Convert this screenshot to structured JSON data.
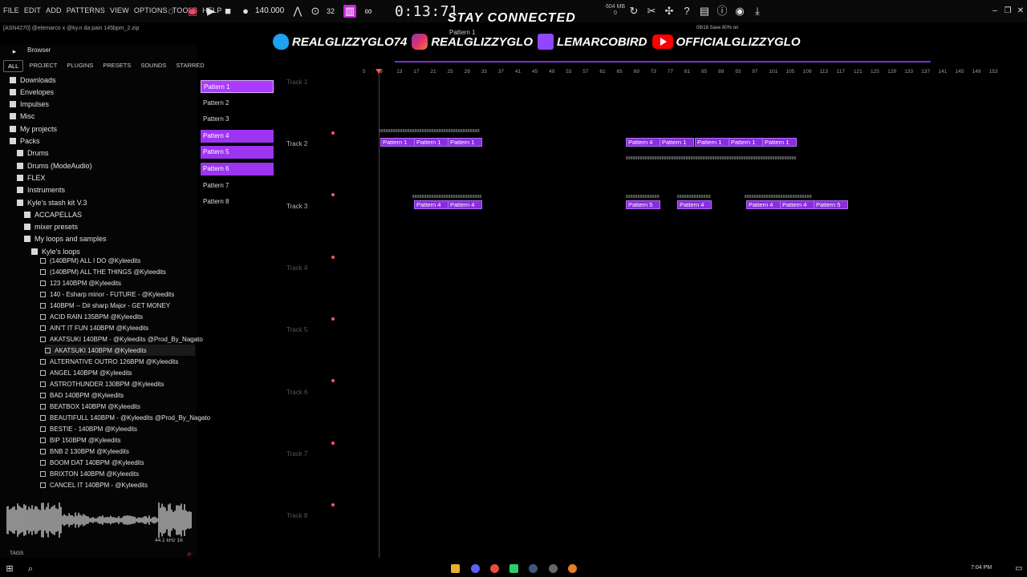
{
  "menu": [
    "FILE",
    "EDIT",
    "ADD",
    "PATTERNS",
    "VIEW",
    "OPTIONS",
    "TOOLS",
    "HELP"
  ],
  "transport": {
    "tempo": "140.000",
    "time": "0:13:71"
  },
  "system": {
    "ram": "604 MB",
    "cpu": "0"
  },
  "project_name": "[ASN4270] @elemarco x @ky.n da pain 145bpm_2.zip",
  "pattern_selector": "Pattern 1",
  "hint": "09/18 Save 80% on",
  "overlay": {
    "stay_connected": "STAY CONNECTED",
    "socials": [
      {
        "icon": "twitter-icon",
        "handle": "REALGLIZZYGLO74",
        "color": "#1da1f2"
      },
      {
        "icon": "instagram-icon",
        "handle": "REALGLIZZYGLO",
        "color": "#e1306c"
      },
      {
        "icon": "twitch-icon",
        "handle": "LEMARCOBIRD",
        "color": "#9146ff"
      },
      {
        "icon": "youtube-icon",
        "handle": "OFFICIALGLIZZYGLO",
        "color": "#ff0000"
      }
    ]
  },
  "browser": {
    "title": "Browser",
    "tabs": [
      "ALL",
      "PROJECT",
      "PLUGINS",
      "PRESETS",
      "SOUNDS",
      "STARRED"
    ],
    "folders": [
      {
        "label": "Downloads",
        "level": 0
      },
      {
        "label": "Envelopes",
        "level": 0
      },
      {
        "label": "Impulses",
        "level": 0
      },
      {
        "label": "Misc",
        "level": 0
      },
      {
        "label": "My projects",
        "level": 0
      },
      {
        "label": "Packs",
        "level": 0
      },
      {
        "label": "Drums",
        "level": 1
      },
      {
        "label": "Drums (ModeAudio)",
        "level": 1
      },
      {
        "label": "FLEX",
        "level": 1
      },
      {
        "label": "Instruments",
        "level": 1
      },
      {
        "label": "Kyle's stash kit V.3",
        "level": 1
      },
      {
        "label": "ACCAPELLAS",
        "level": 2
      },
      {
        "label": "mixer presets",
        "level": 2
      },
      {
        "label": "My loops and samples",
        "level": 2
      },
      {
        "label": "Kyle's loops",
        "level": 3
      }
    ],
    "files": [
      "(140BPM) ALL I DO @Kyleedits",
      "(140BPM) ALL THE THINGS @Kyleedits",
      "123 140BPM @Kyleedits",
      "140 - Esharp minor - FUTURE - @Kyleedits",
      "140BPM -- D# sharp Major - GET MONEY",
      "ACID RAIN 135BPM @Kyleedits",
      "AIN'T IT FUN 140BPM @Kyleedits",
      "AKATSUKI 140BPM - @Kyleedits @Prod_By_Nagato",
      "AKATSUKI 140BPM @Kyleedits",
      "ALTERNATIVE OUTRO 126BPM @Kyleedits",
      "ANGEL 140BPM @Kyleedits",
      "ASTROTHUNDER 130BPM @Kyleedits",
      "BAD 140BPM @Kyleedits",
      "BEATBOX 140BPM @Kyleedits",
      "BEAUTIFULL 140BPM - @Kyleedits @Prod_By_Nagato",
      "BESTIE - 140BPM @Kyleedits",
      "BIP 150BPM @Kyleedits",
      "BNB 2 130BPM @Kyleedits",
      "BOOM DAT 140BPM @Kyleedits",
      "BRIXTON 140BPM @Kyleedits",
      "CANCEL IT 140BPM - @Kyleedits"
    ],
    "selected_file_index": 8,
    "sample_info": "44.1 kHz 16",
    "tags_label": "TAGS"
  },
  "patterns": [
    {
      "label": "Pattern 1",
      "active": true,
      "selected": true
    },
    {
      "label": "Pattern 2",
      "active": false
    },
    {
      "label": "Pattern 3",
      "active": false
    },
    {
      "label": "Pattern 4",
      "active": true
    },
    {
      "label": "Pattern 5",
      "active": true
    },
    {
      "label": "Pattern 6",
      "active": true
    },
    {
      "label": "Pattern 7",
      "active": false
    },
    {
      "label": "Pattern 8",
      "active": false
    }
  ],
  "playlist": {
    "ruler": [
      "5",
      "9",
      "13",
      "17",
      "21",
      "25",
      "29",
      "33",
      "37",
      "41",
      "45",
      "49",
      "53",
      "57",
      "61",
      "65",
      "69",
      "73",
      "77",
      "81",
      "85",
      "89",
      "93",
      "97",
      "101",
      "105",
      "109",
      "113",
      "117",
      "121",
      "125",
      "129",
      "133",
      "137",
      "141",
      "145",
      "149",
      "153"
    ],
    "tracks": [
      {
        "label": "Track 1",
        "dim": true
      },
      {
        "label": "Track 2",
        "dim": false
      },
      {
        "label": "Track 3",
        "dim": false
      },
      {
        "label": "Track 4",
        "dim": true
      },
      {
        "label": "Track 5",
        "dim": true
      },
      {
        "label": "Track 6",
        "dim": true
      },
      {
        "label": "Track 7",
        "dim": true
      },
      {
        "label": "Track 8",
        "dim": true
      }
    ],
    "clips": [
      {
        "track": 1,
        "label": "Pattern 1"
      },
      {
        "track": 1,
        "label": "Pattern 1"
      },
      {
        "track": 1,
        "label": "Pattern 1"
      },
      {
        "track": 1,
        "label": "Pattern 4"
      },
      {
        "track": 1,
        "label": "Pattern 1"
      },
      {
        "track": 1,
        "label": "Pattern 1"
      },
      {
        "track": 1,
        "label": "Pattern 1"
      },
      {
        "track": 1,
        "label": "Pattern 1"
      },
      {
        "track": 2,
        "label": "Pattern 4"
      },
      {
        "track": 2,
        "label": "Pattern 4"
      },
      {
        "track": 2,
        "label": "Pattern 5"
      },
      {
        "track": 2,
        "label": "Pattern 4"
      },
      {
        "track": 2,
        "label": "Pattern 4"
      },
      {
        "track": 2,
        "label": "Pattern 4"
      },
      {
        "track": 2,
        "label": "Pattern 5"
      }
    ]
  },
  "taskbar": {
    "time": "7:04 PM"
  },
  "colors": {
    "accent": "#9c34f2",
    "clip": "#8a2ce0",
    "playhead": "#ff5555"
  }
}
